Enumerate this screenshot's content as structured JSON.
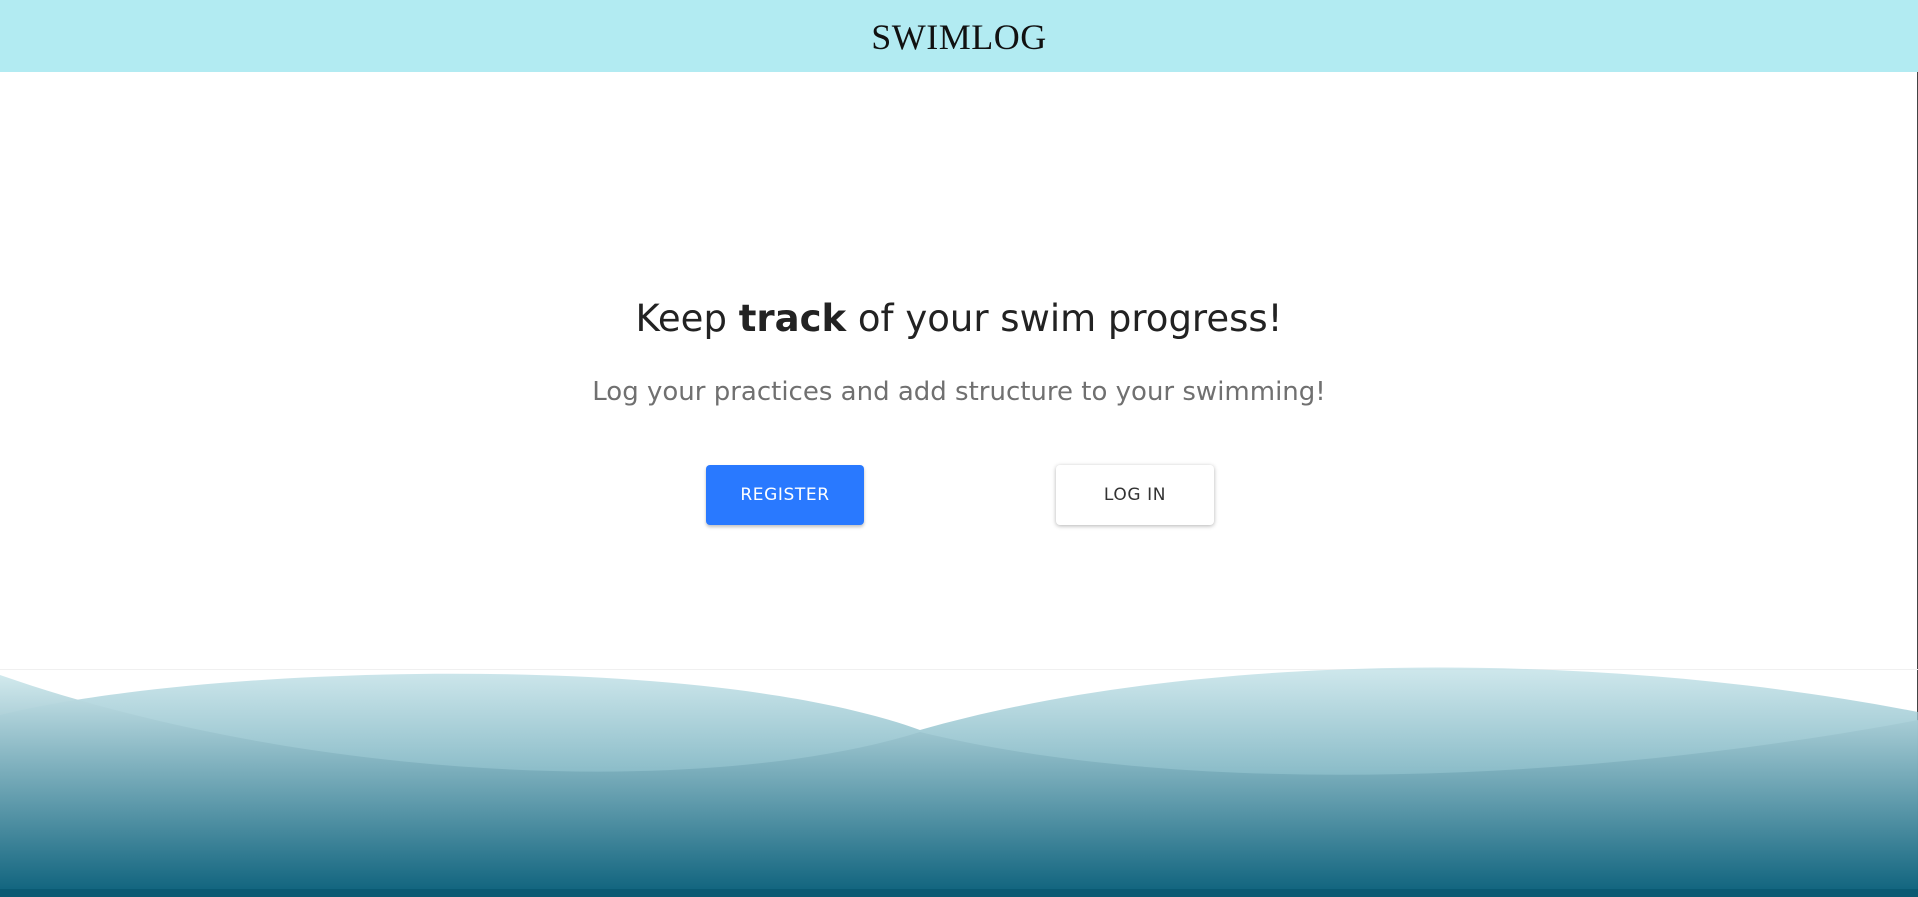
{
  "header": {
    "brand": "SWIMLOG"
  },
  "hero": {
    "headline_before": "Keep ",
    "headline_bold": "track",
    "headline_after": " of your swim progress!",
    "subline": "Log your practices and add structure to your swimming!"
  },
  "actions": {
    "register_label": "REGISTER",
    "login_label": "LOG IN"
  },
  "colors": {
    "header_bg": "#b2ebf2",
    "primary_button": "#2979ff",
    "wave_top": "#cfe8ec",
    "wave_bottom": "#0a5f7a"
  }
}
